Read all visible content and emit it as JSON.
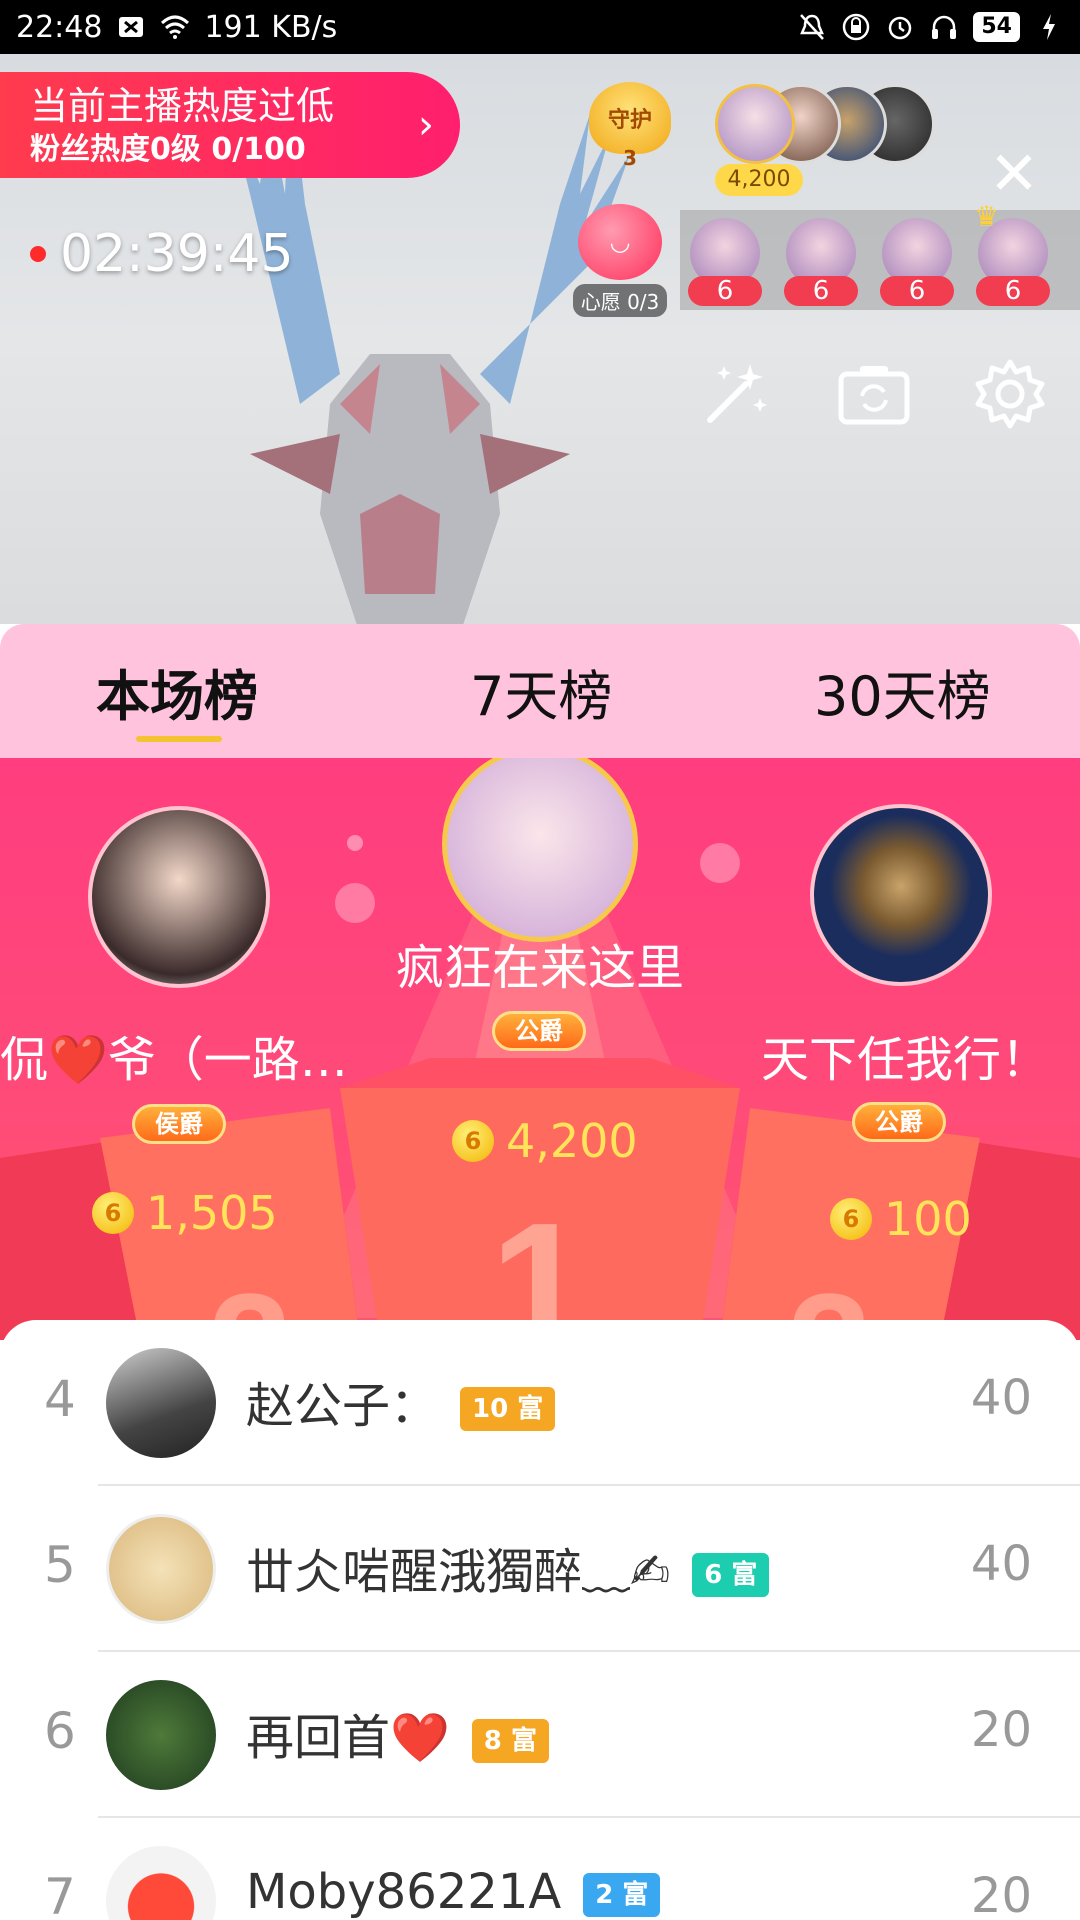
{
  "status_bar": {
    "time": "22:48",
    "speed": "191 KB/s",
    "battery": "54"
  },
  "live": {
    "heat_title": "当前主播热度过低",
    "heat_sub": "粉丝热度0级 0/100",
    "timer": "02:39:45",
    "guard_label": "守护",
    "guard_count": "3",
    "top_viewer_coins": "4,200",
    "wish_label": "心愿 0/3",
    "fan_badges": [
      "6",
      "6",
      "6",
      "6"
    ]
  },
  "tabs": [
    {
      "label": "本场榜",
      "active": true
    },
    {
      "label": "7天榜",
      "active": false
    },
    {
      "label": "30天榜",
      "active": false
    }
  ],
  "podium": {
    "first": {
      "name": "疯狂在来这里",
      "title": "公爵",
      "coins": "4,200",
      "avatar": "baby"
    },
    "second": {
      "name": "侃❤️爷（一路…",
      "title": "侯爵",
      "coins": "1,505",
      "avatar": "woman"
    },
    "third": {
      "name": "天下任我行！",
      "title": "公爵",
      "coins": "100",
      "avatar": "eagle-seal"
    }
  },
  "ranking": [
    {
      "rank": "4",
      "name": "赵公子：",
      "wealth_level": "10",
      "wealth_label": "富",
      "wealth_color": "#f5a623",
      "score": "40"
    },
    {
      "rank": "5",
      "name": "丗仌啱醒涐獨醉﹏✍",
      "wealth_level": "6",
      "wealth_label": "富",
      "wealth_color": "#1ccdb0",
      "score": "40"
    },
    {
      "rank": "6",
      "name": "再回首❤️",
      "wealth_level": "8",
      "wealth_label": "富",
      "wealth_color": "#f5a623",
      "score": "20"
    },
    {
      "rank": "7",
      "name": "Moby86221A",
      "wealth_level": "2",
      "wealth_label": "富",
      "wealth_color": "#39a8f0",
      "score": "20"
    }
  ],
  "colors": {
    "accent_pink": "#ff3d7f",
    "tab_bg": "#ffc3dd",
    "coin_text": "#ffe45a"
  }
}
